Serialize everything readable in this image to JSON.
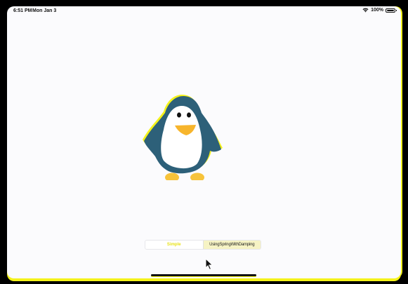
{
  "status_bar": {
    "time": "6:51 PM",
    "date": "Mon Jan 3",
    "battery": "100%"
  },
  "icons": {
    "wifi": "wifi-icon",
    "battery": "battery-icon",
    "cursor": "arrow-cursor-icon",
    "penguin": "penguin-image"
  },
  "segmented_control": {
    "options": [
      "Simple",
      "UsingSpringWithDamping"
    ],
    "selected": "Simple"
  },
  "colors": {
    "accent": "#f4f21a",
    "penguin_body": "#2d6079",
    "penguin_feet": "#f7c33a",
    "background": "#fbfbfd"
  }
}
